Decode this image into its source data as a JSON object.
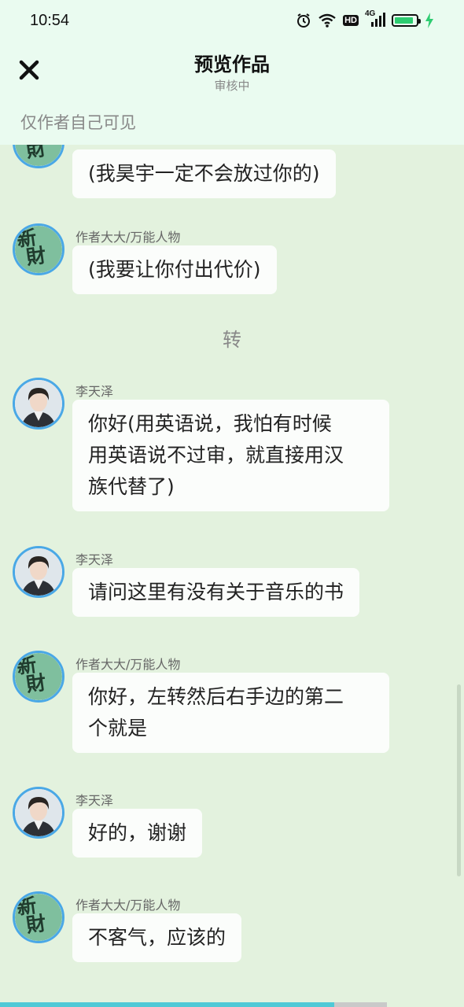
{
  "status_bar": {
    "time": "10:54",
    "icons": [
      "alarm-icon",
      "wifi-icon",
      "hd-badge",
      "4g-signal-icon",
      "battery-icon",
      "charging-icon"
    ],
    "hd_label": "HD",
    "network_label": "4G",
    "battery_level": 0.9,
    "battery_color": "#2ecc71"
  },
  "header": {
    "title": "预览作品",
    "subtitle": "审核中",
    "visibility_note": "仅作者自己可见"
  },
  "messages": [
    {
      "sender": "",
      "avatar": "narrator",
      "text": "(我昊宇一定不会放过你的)"
    },
    {
      "sender": "作者大大/万能人物",
      "avatar": "narrator",
      "text": "(我要让你付出代价)"
    },
    {
      "divider_text": "转"
    },
    {
      "sender": "李天泽",
      "avatar": "person",
      "lines": [
        "你好(用英语说，我怕有时候",
        "用英语说不过审，就直接用汉",
        "族代替了)"
      ]
    },
    {
      "sender": "李天泽",
      "avatar": "person",
      "text": "请问这里有没有关于音乐的书"
    },
    {
      "sender": "作者大大/万能人物",
      "avatar": "narrator",
      "lines": [
        "你好，左转然后右手边的第二",
        "个就是"
      ]
    },
    {
      "sender": "李天泽",
      "avatar": "person",
      "text": "好的，谢谢"
    },
    {
      "sender": "作者大大/万能人物",
      "avatar": "narrator",
      "text": "不客气，应该的"
    }
  ],
  "narrator_avatar_glyph": "新",
  "narrator_avatar_glyph2": "財",
  "reading_progress": 0.72,
  "colors": {
    "background": "#e3f2de",
    "header_background": "#eafbf0",
    "bubble": "#fbfdfb",
    "avatar_ring": "#4aa8e6",
    "progress": "#4fc9d6"
  }
}
